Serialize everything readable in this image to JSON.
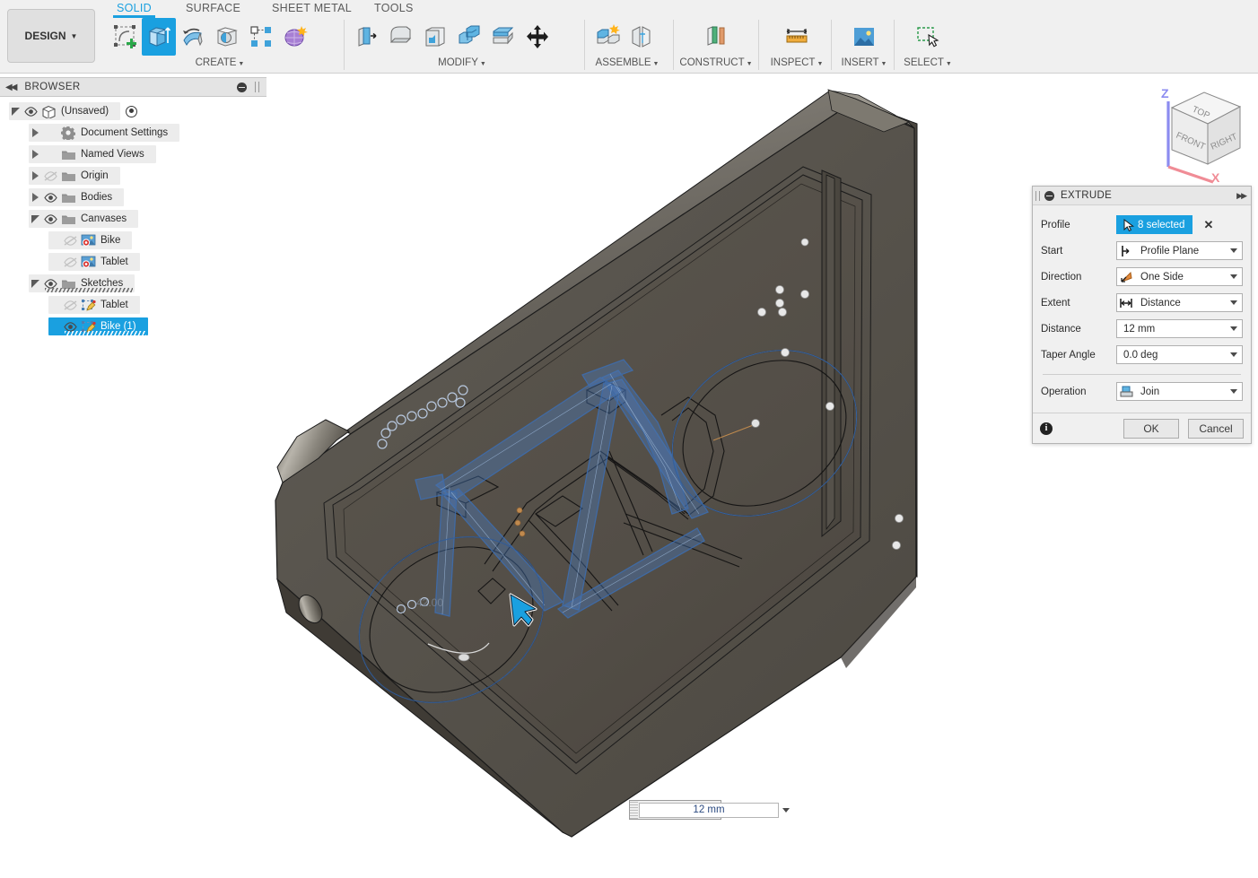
{
  "app": {
    "workspace_label": "DESIGN",
    "tabs": [
      {
        "id": "solid",
        "label": "SOLID",
        "active": true
      },
      {
        "id": "surface",
        "label": "SURFACE",
        "active": false
      },
      {
        "id": "sheet_metal",
        "label": "SHEET METAL",
        "active": false
      },
      {
        "id": "tools",
        "label": "TOOLS",
        "active": false
      }
    ],
    "accent_color": "#1aa0e0",
    "panel_bg": "#f0f0f0",
    "canvas_bg": "#ffffff"
  },
  "toolbar": {
    "groups": [
      {
        "label": "CREATE",
        "has_dropdown": true,
        "buttons": [
          {
            "icon": "create-sketch-icon",
            "selected": false
          },
          {
            "icon": "extrude-icon",
            "selected": true
          },
          {
            "icon": "revolve-icon",
            "selected": false
          },
          {
            "icon": "sweep-icon",
            "selected": false
          },
          {
            "icon": "pattern-icon",
            "selected": false
          },
          {
            "icon": "form-icon",
            "selected": false
          }
        ]
      },
      {
        "label": "MODIFY",
        "has_dropdown": true,
        "buttons": [
          {
            "icon": "press-pull-icon",
            "selected": false
          },
          {
            "icon": "fillet-icon",
            "selected": false
          },
          {
            "icon": "shell-icon",
            "selected": false
          },
          {
            "icon": "combine-icon",
            "selected": false
          },
          {
            "icon": "split-face-icon",
            "selected": false
          },
          {
            "icon": "move-copy-icon",
            "selected": false
          }
        ]
      },
      {
        "label": "ASSEMBLE",
        "has_dropdown": true,
        "buttons": [
          {
            "icon": "new-component-icon",
            "selected": false
          },
          {
            "icon": "joint-icon",
            "selected": false
          }
        ]
      },
      {
        "label": "CONSTRUCT",
        "has_dropdown": true,
        "buttons": [
          {
            "icon": "offset-plane-icon",
            "selected": false
          }
        ]
      },
      {
        "label": "INSPECT",
        "has_dropdown": true,
        "buttons": [
          {
            "icon": "measure-icon",
            "selected": false
          }
        ]
      },
      {
        "label": "INSERT",
        "has_dropdown": true,
        "buttons": [
          {
            "icon": "insert-canvas-icon",
            "selected": false
          }
        ]
      },
      {
        "label": "SELECT",
        "has_dropdown": true,
        "buttons": [
          {
            "icon": "select-cursor-icon",
            "selected": false
          }
        ]
      }
    ]
  },
  "browser": {
    "title": "BROWSER",
    "collapse_icon": "collapse-left-icon",
    "minimize_icon": "minimize-icon",
    "resize_icon": "resize-grip-icon",
    "tree": [
      {
        "id": "root",
        "label": "(Unsaved)",
        "indent": 0,
        "arrow": "open",
        "eye": "visible",
        "icon": "document-cube-icon",
        "radio": true,
        "selected": false,
        "hatched": false
      },
      {
        "id": "document-settings",
        "label": "Document Settings",
        "indent": 1,
        "arrow": "closed",
        "eye": "none",
        "icon": "gear-icon",
        "radio": false,
        "selected": false,
        "hatched": false
      },
      {
        "id": "named-views",
        "label": "Named Views",
        "indent": 1,
        "arrow": "closed",
        "eye": "none",
        "icon": "folder-icon",
        "radio": false,
        "selected": false,
        "hatched": false
      },
      {
        "id": "origin",
        "label": "Origin",
        "indent": 1,
        "arrow": "closed",
        "eye": "hidden",
        "icon": "folder-icon",
        "radio": false,
        "selected": false,
        "hatched": false
      },
      {
        "id": "bodies",
        "label": "Bodies",
        "indent": 1,
        "arrow": "closed",
        "eye": "visible",
        "icon": "folder-icon",
        "radio": false,
        "selected": false,
        "hatched": false
      },
      {
        "id": "canvases",
        "label": "Canvases",
        "indent": 1,
        "arrow": "open",
        "eye": "visible",
        "icon": "folder-icon",
        "radio": false,
        "selected": false,
        "hatched": false
      },
      {
        "id": "canvas-bike",
        "label": "Bike",
        "indent": 2,
        "arrow": "none",
        "eye": "hidden",
        "icon": "canvas-image-icon",
        "radio": false,
        "selected": false,
        "hatched": false
      },
      {
        "id": "canvas-tablet",
        "label": "Tablet",
        "indent": 2,
        "arrow": "none",
        "eye": "hidden",
        "icon": "canvas-image-icon",
        "radio": false,
        "selected": false,
        "hatched": false
      },
      {
        "id": "sketches",
        "label": "Sketches",
        "indent": 1,
        "arrow": "open",
        "eye": "visible",
        "icon": "folder-icon",
        "radio": false,
        "selected": false,
        "hatched": true
      },
      {
        "id": "sketch-tablet",
        "label": "Tablet",
        "indent": 2,
        "arrow": "none",
        "eye": "hidden",
        "icon": "sketch-icon",
        "radio": false,
        "selected": false,
        "hatched": false
      },
      {
        "id": "sketch-bike",
        "label": "Bike (1)",
        "indent": 2,
        "arrow": "none",
        "eye": "visible",
        "icon": "sketch-icon",
        "radio": false,
        "selected": true,
        "hatched": true
      }
    ]
  },
  "viewcube": {
    "faces": {
      "top": "TOP",
      "front": "FRONT",
      "right": "RIGHT"
    },
    "axes": {
      "z": "Z",
      "x": "X"
    },
    "z_color": "#8c8cf0",
    "x_color": "#f08c96"
  },
  "canvas": {
    "dimension_input": {
      "value": "12 mm",
      "placeholder": "12 mm"
    },
    "body_color": "#57534c",
    "sketch_color": "#3d6fb5",
    "cursor_icon": "arrow-cursor-icon"
  },
  "extrude_dialog": {
    "title": "EXTRUDE",
    "minimize_icon": "minimize-icon",
    "expand_icon": "expand-right-icon",
    "drag_icon": "drag-grip-icon",
    "rows": [
      {
        "id": "profile",
        "label": "Profile",
        "kind": "selection",
        "value": "8 selected",
        "icon": "select-arrow-icon",
        "clear_icon": "clear-x-icon"
      },
      {
        "id": "start",
        "label": "Start",
        "kind": "combo",
        "value": "Profile Plane",
        "icon": "profile-plane-icon"
      },
      {
        "id": "direction",
        "label": "Direction",
        "kind": "combo",
        "value": "One Side",
        "icon": "one-side-icon"
      },
      {
        "id": "extent",
        "label": "Extent",
        "kind": "combo",
        "value": "Distance",
        "icon": "distance-icon"
      },
      {
        "id": "distance",
        "label": "Distance",
        "kind": "field",
        "value": "12 mm",
        "icon": ""
      },
      {
        "id": "taper_angle",
        "label": "Taper Angle",
        "kind": "field",
        "value": "0.0 deg",
        "icon": ""
      },
      {
        "id": "operation",
        "label": "Operation",
        "kind": "combo",
        "value": "Join",
        "icon": "join-icon"
      }
    ],
    "footer": {
      "info_icon": "info-icon",
      "ok_label": "OK",
      "cancel_label": "Cancel"
    }
  }
}
